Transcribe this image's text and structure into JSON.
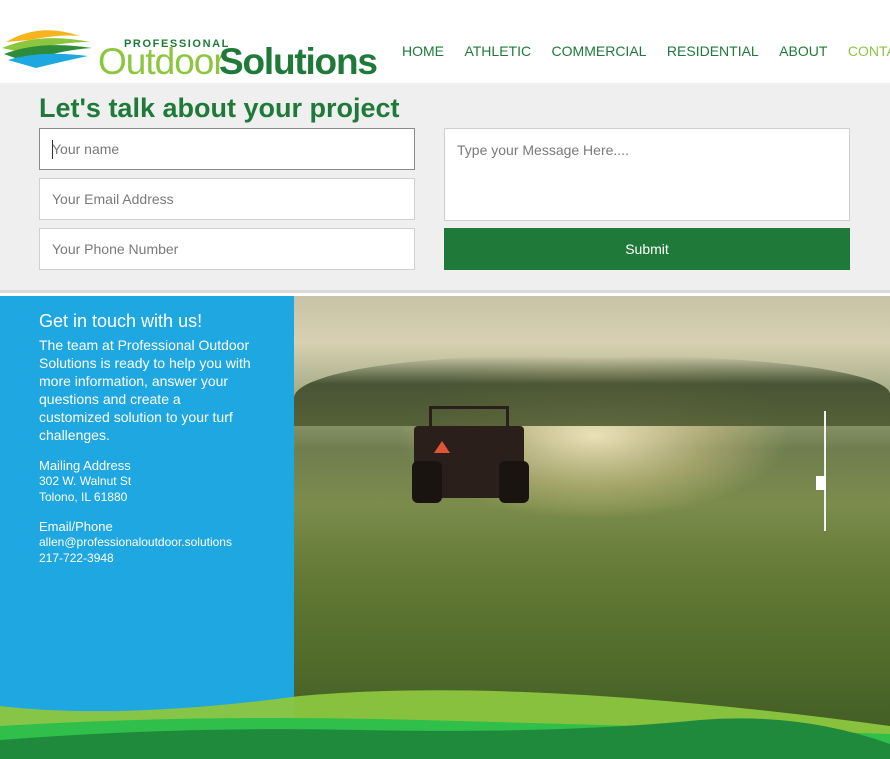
{
  "brand": {
    "small": "PROFESSIONAL",
    "outdoor": "Outdoor",
    "solutions": "Solutions",
    "colors": {
      "dark_green": "#1f7a3a",
      "light_green": "#8cc63f",
      "blue": "#1ea7e1"
    }
  },
  "nav": {
    "items": [
      {
        "label": "HOME"
      },
      {
        "label": "ATHLETIC"
      },
      {
        "label": "COMMERCIAL"
      },
      {
        "label": "RESIDENTIAL"
      },
      {
        "label": "ABOUT"
      },
      {
        "label": "CONTACT"
      }
    ],
    "active": "CONTACT"
  },
  "form": {
    "title": "Let's talk about your project",
    "name_placeholder": "Your name",
    "email_placeholder": "Your Email Address",
    "phone_placeholder": "Your Phone Number",
    "message_placeholder": "Type your Message Here....",
    "submit_label": "Submit"
  },
  "contact": {
    "heading": "Get in touch with us!",
    "description": "The team at Professional Outdoor Solutions is ready to help you with more information, answer your questions and create a customized solution to your turf challenges.",
    "mailing_label": "Mailing Address",
    "address_line1": "302 W. Walnut St",
    "address_line2": "Tolono, IL 61880",
    "email_phone_label": "Email/Phone",
    "email": "allen@professionaloutdoor.solutions",
    "phone": "217-722-3948"
  },
  "icons": {
    "logo": "landscape-logo-icon"
  }
}
